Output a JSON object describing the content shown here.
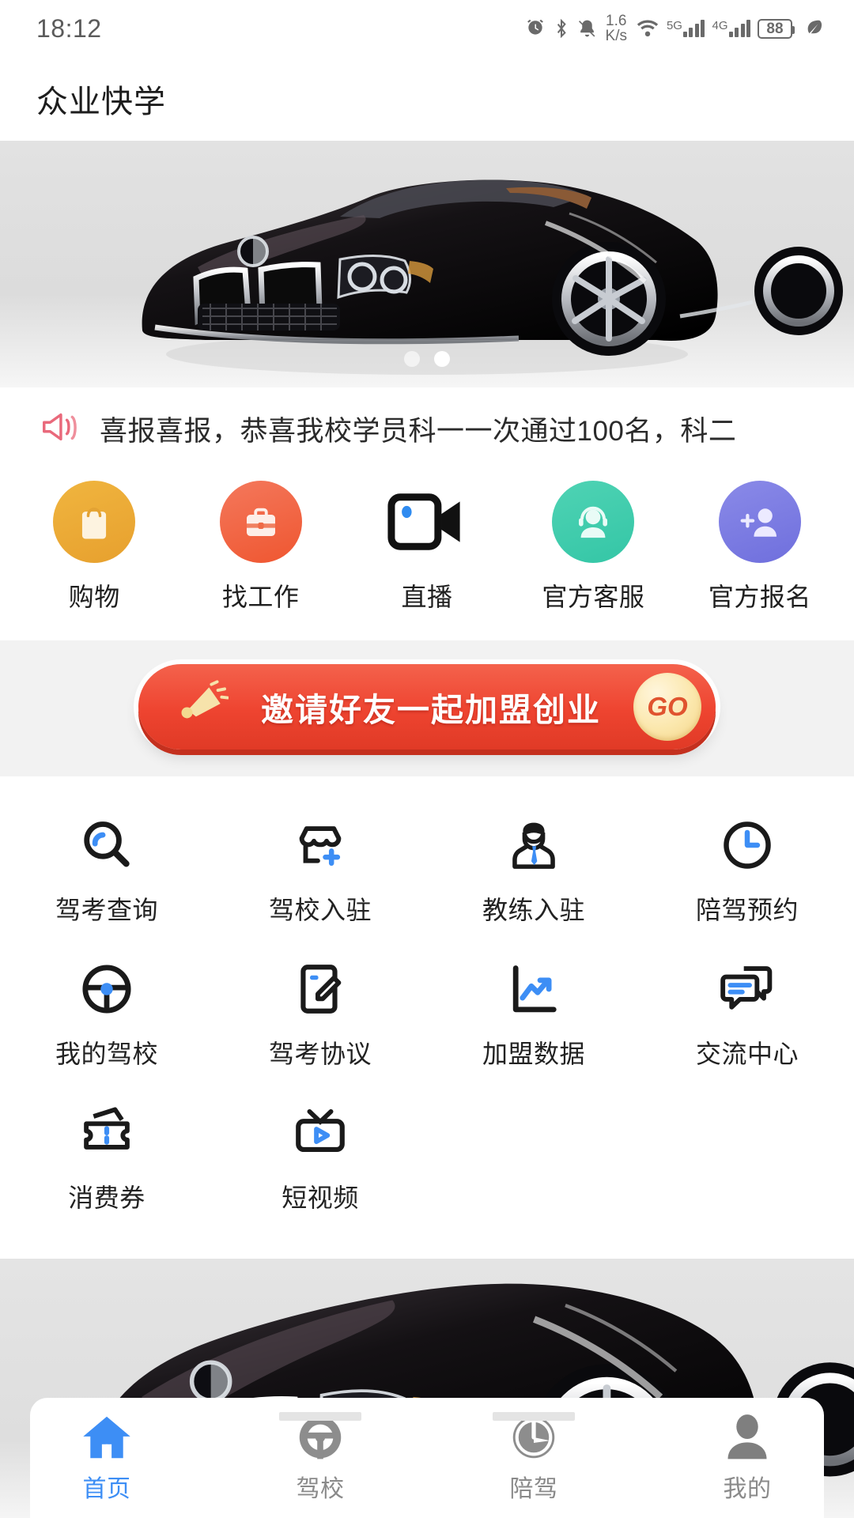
{
  "status_bar": {
    "time": "18:12",
    "net_speed_value": "1.6",
    "net_speed_unit": "K/s",
    "signal_5g_label": "5G",
    "signal_4g_label": "4G",
    "battery_level": "88",
    "icons": [
      "alarm-icon",
      "bluetooth-icon",
      "mute-icon",
      "wifi-icon",
      "signal-5g-icon",
      "signal-4g-icon",
      "battery-icon",
      "leaf-icon"
    ]
  },
  "header": {
    "title": "众业快学"
  },
  "carousel": {
    "slide_alt": "black BMW convertible car",
    "dots": 2,
    "active_dot_index": 1
  },
  "notice": {
    "icon": "megaphone-icon",
    "icon_color": "#e9697b",
    "text": "喜报喜报，恭喜我校学员科一一次通过100名，科二"
  },
  "quick_actions": [
    {
      "label": "购物",
      "icon": "shopping-bag-icon",
      "color": "#eaa93a"
    },
    {
      "label": "找工作",
      "icon": "briefcase-icon",
      "color": "#ef5c3c"
    },
    {
      "label": "直播",
      "icon": "video-camera-icon",
      "color": "#111111"
    },
    {
      "label": "官方客服",
      "icon": "headset-support-icon",
      "color": "#40cdab"
    },
    {
      "label": "官方报名",
      "icon": "add-user-icon",
      "color": "#7878e2"
    }
  ],
  "invite_banner": {
    "text": "邀请好友一起加盟创业",
    "button_label": "GO",
    "icon": "megaphone-icon",
    "color": "#ee4430"
  },
  "feature_grid": [
    {
      "label": "驾考查询",
      "icon": "magnifier-icon"
    },
    {
      "label": "驾校入驻",
      "icon": "shop-add-icon"
    },
    {
      "label": "教练入驻",
      "icon": "coach-person-icon"
    },
    {
      "label": "陪驾预约",
      "icon": "clock-icon"
    },
    {
      "label": "我的驾校",
      "icon": "steering-wheel-icon"
    },
    {
      "label": "驾考协议",
      "icon": "document-edit-icon"
    },
    {
      "label": "加盟数据",
      "icon": "chart-trend-icon"
    },
    {
      "label": "交流中心",
      "icon": "chat-bubbles-icon"
    },
    {
      "label": "消费券",
      "icon": "coupon-ticket-icon"
    },
    {
      "label": "短视频",
      "icon": "video-play-icon"
    }
  ],
  "promo": {
    "image_alt": "black BMW car front view"
  },
  "bottom_nav": {
    "active_index": 0,
    "active_color": "#3d8ef5",
    "inactive_color": "#8a8a8a",
    "items": [
      {
        "label": "首页",
        "icon": "home-icon"
      },
      {
        "label": "驾校",
        "icon": "steering-wheel-icon"
      },
      {
        "label": "陪驾",
        "icon": "gauge-icon"
      },
      {
        "label": "我的",
        "icon": "person-icon"
      }
    ]
  }
}
